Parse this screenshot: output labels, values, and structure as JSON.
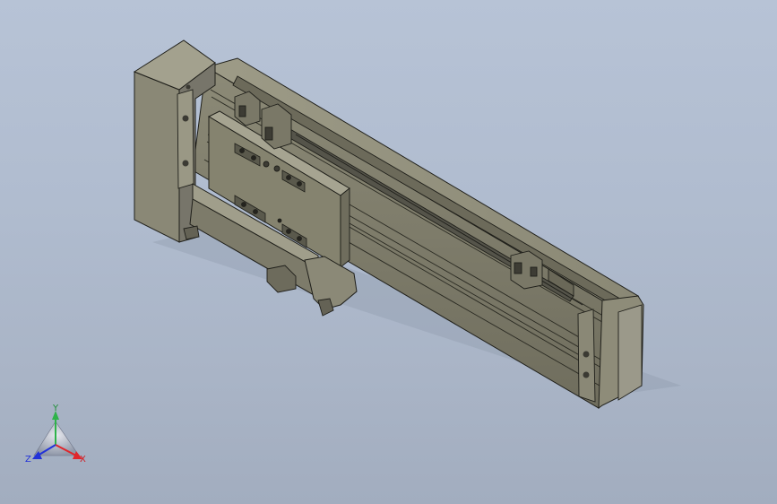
{
  "triad": {
    "y_label": "Y",
    "z_label": "Z",
    "x_label": "X",
    "colors": {
      "x": "#e0262c",
      "y": "#2fb34a",
      "z": "#2233d8"
    }
  },
  "model": {
    "icon": "linear-actuator-3d-model",
    "body_color": "#7e7c6b",
    "body_dark": "#5f5e50",
    "body_light": "#a7a592",
    "edge_color": "#1f1f1a",
    "background_top": "#b7c3d6",
    "background_bottom": "#a2adbf"
  }
}
